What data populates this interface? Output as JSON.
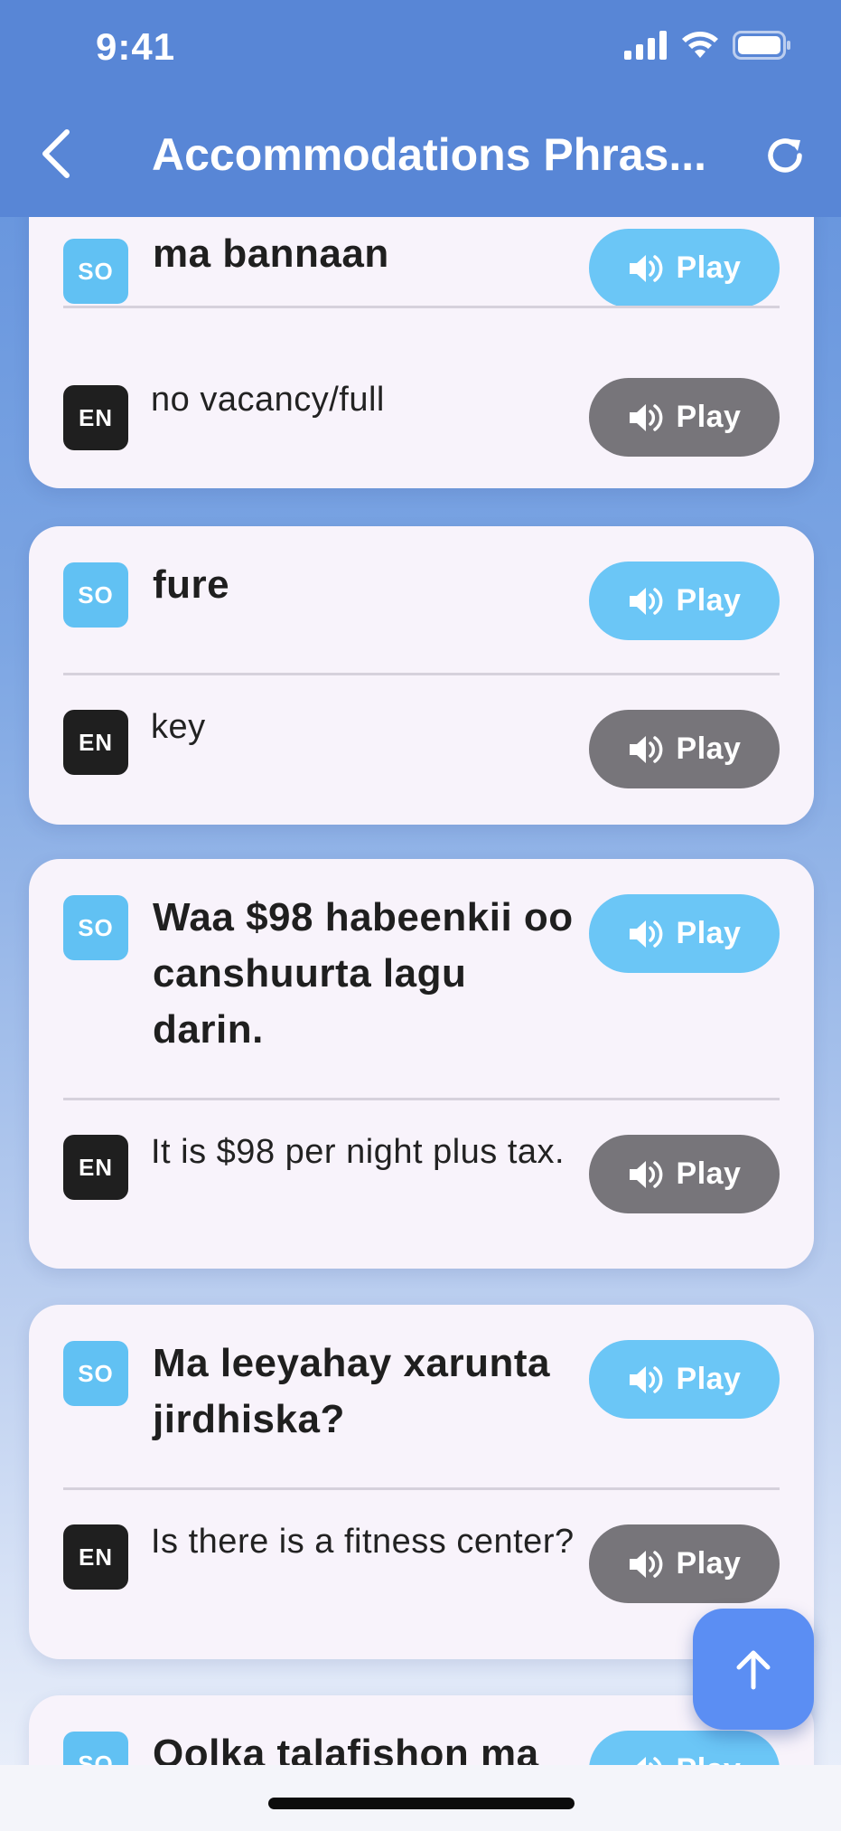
{
  "status": {
    "time": "9:41"
  },
  "nav": {
    "title": "Accommodations Phras..."
  },
  "phrases": [
    {
      "so": "ma bannaan",
      "en": "no vacancy/full"
    },
    {
      "so": "fure",
      "en": "key"
    },
    {
      "so": "Waa $98 habeenkii oo canshuurta lagu darin.",
      "en": "It is $98 per night plus tax."
    },
    {
      "so": "Ma leeyahay xarunta jirdhiska?",
      "en": "Is there is a fitness center?"
    },
    {
      "so": "Qolka talafishon ma"
    }
  ],
  "labels": {
    "so_badge": "SO",
    "en_badge": "EN",
    "play": "Play"
  },
  "colors": {
    "header": "#5886d6",
    "play_so": "#6bc6f6",
    "play_en": "#77757a",
    "fab": "#5b8ef3"
  },
  "icons": [
    "back-icon",
    "refresh-icon",
    "speaker-icon",
    "arrow-up-icon",
    "signal-icon",
    "wifi-icon",
    "battery-icon"
  ]
}
